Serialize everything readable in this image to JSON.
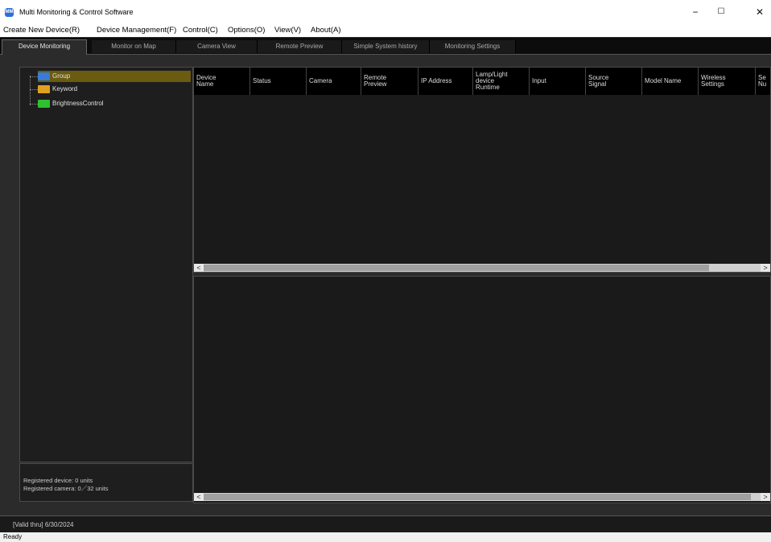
{
  "window": {
    "title": "Multi Monitoring & Control Software",
    "icon_label": "MM",
    "minimize": "−",
    "maximize": "☐",
    "close": "✕"
  },
  "menu": [
    "Create New Device(R)",
    "Device Management(F)",
    "Control(C)",
    "Options(O)",
    "View(V)",
    "About(A)"
  ],
  "tabs": [
    "Device Monitoring",
    "Monitor on Map",
    "Camera View",
    "Remote Preview",
    "Simple System history",
    "Monitoring Settings"
  ],
  "tree": [
    {
      "label": "Group",
      "color": "#3a7bd5"
    },
    {
      "label": "Keyword",
      "color": "#e0a020"
    },
    {
      "label": "BrightnessControl",
      "color": "#2fbf2f"
    }
  ],
  "registered": {
    "devices": "Registered device: 0 units",
    "cameras": "Registered camera: 0／32 units"
  },
  "table": {
    "columns": [
      "Device\nName",
      "Status",
      "Camera",
      "Remote\nPreview",
      "IP Address",
      "Lamp/Light\ndevice\nRuntime",
      "Input",
      "Source\nSignal",
      "Model Name",
      "Wireless\nSettings",
      "Se\nNu"
    ]
  },
  "scroll": {
    "left": "<",
    "right": ">"
  },
  "footer": {
    "valid_thru": "[Valid thru] 6/30/2024"
  },
  "status": {
    "text": "Ready"
  }
}
